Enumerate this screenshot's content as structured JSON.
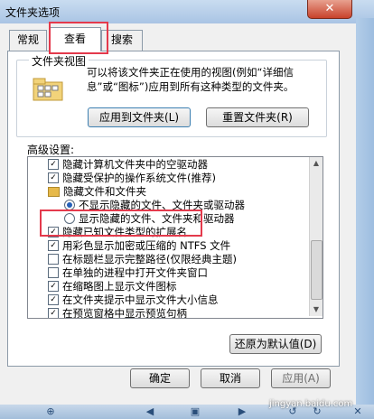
{
  "window": {
    "title": "文件夹选项",
    "close_glyph": "✕"
  },
  "tabs": [
    {
      "label": "常规"
    },
    {
      "label": "查看"
    },
    {
      "label": "搜索"
    }
  ],
  "folder_views": {
    "group_label": "文件夹视图",
    "description_lines": [
      "可以将该文件夹正在使用的视图(例如“详细信",
      "息”或“图标”)应用到所有这种类型的文件夹。"
    ],
    "apply_button": "应用到文件夹(L)",
    "reset_button": "重置文件夹(R)"
  },
  "advanced": {
    "label": "高级设置:",
    "items": [
      {
        "type": "checkbox",
        "checked": true,
        "label": "隐藏计算机文件夹中的空驱动器"
      },
      {
        "type": "checkbox",
        "checked": true,
        "label": "隐藏受保护的操作系统文件(推荐)"
      },
      {
        "type": "folder",
        "label": "隐藏文件和文件夹"
      },
      {
        "type": "radio",
        "selected": true,
        "label": "不显示隐藏的文件、文件夹或驱动器"
      },
      {
        "type": "radio",
        "selected": false,
        "label": "显示隐藏的文件、文件夹和驱动器"
      },
      {
        "type": "checkbox",
        "checked": true,
        "label": "隐藏已知文件类型的扩展名"
      },
      {
        "type": "checkbox",
        "checked": true,
        "label": "用彩色显示加密或压缩的 NTFS 文件"
      },
      {
        "type": "checkbox",
        "checked": false,
        "label": "在标题栏显示完整路径(仅限经典主题)"
      },
      {
        "type": "checkbox",
        "checked": false,
        "label": "在单独的进程中打开文件夹窗口"
      },
      {
        "type": "checkbox",
        "checked": true,
        "label": "在缩略图上显示文件图标"
      },
      {
        "type": "checkbox",
        "checked": true,
        "label": "在文件夹提示中显示文件大小信息"
      },
      {
        "type": "checkbox",
        "checked": true,
        "label": "在预览窗格中显示预览句柄"
      }
    ],
    "restore_button": "还原为默认值(D)"
  },
  "footer": {
    "ok": "确定",
    "cancel": "取消",
    "apply": "应用(A)"
  },
  "watermark": "jingyan.baidu.com",
  "colors": {
    "highlight": "#e43a4c",
    "accent": "#2560b8"
  }
}
